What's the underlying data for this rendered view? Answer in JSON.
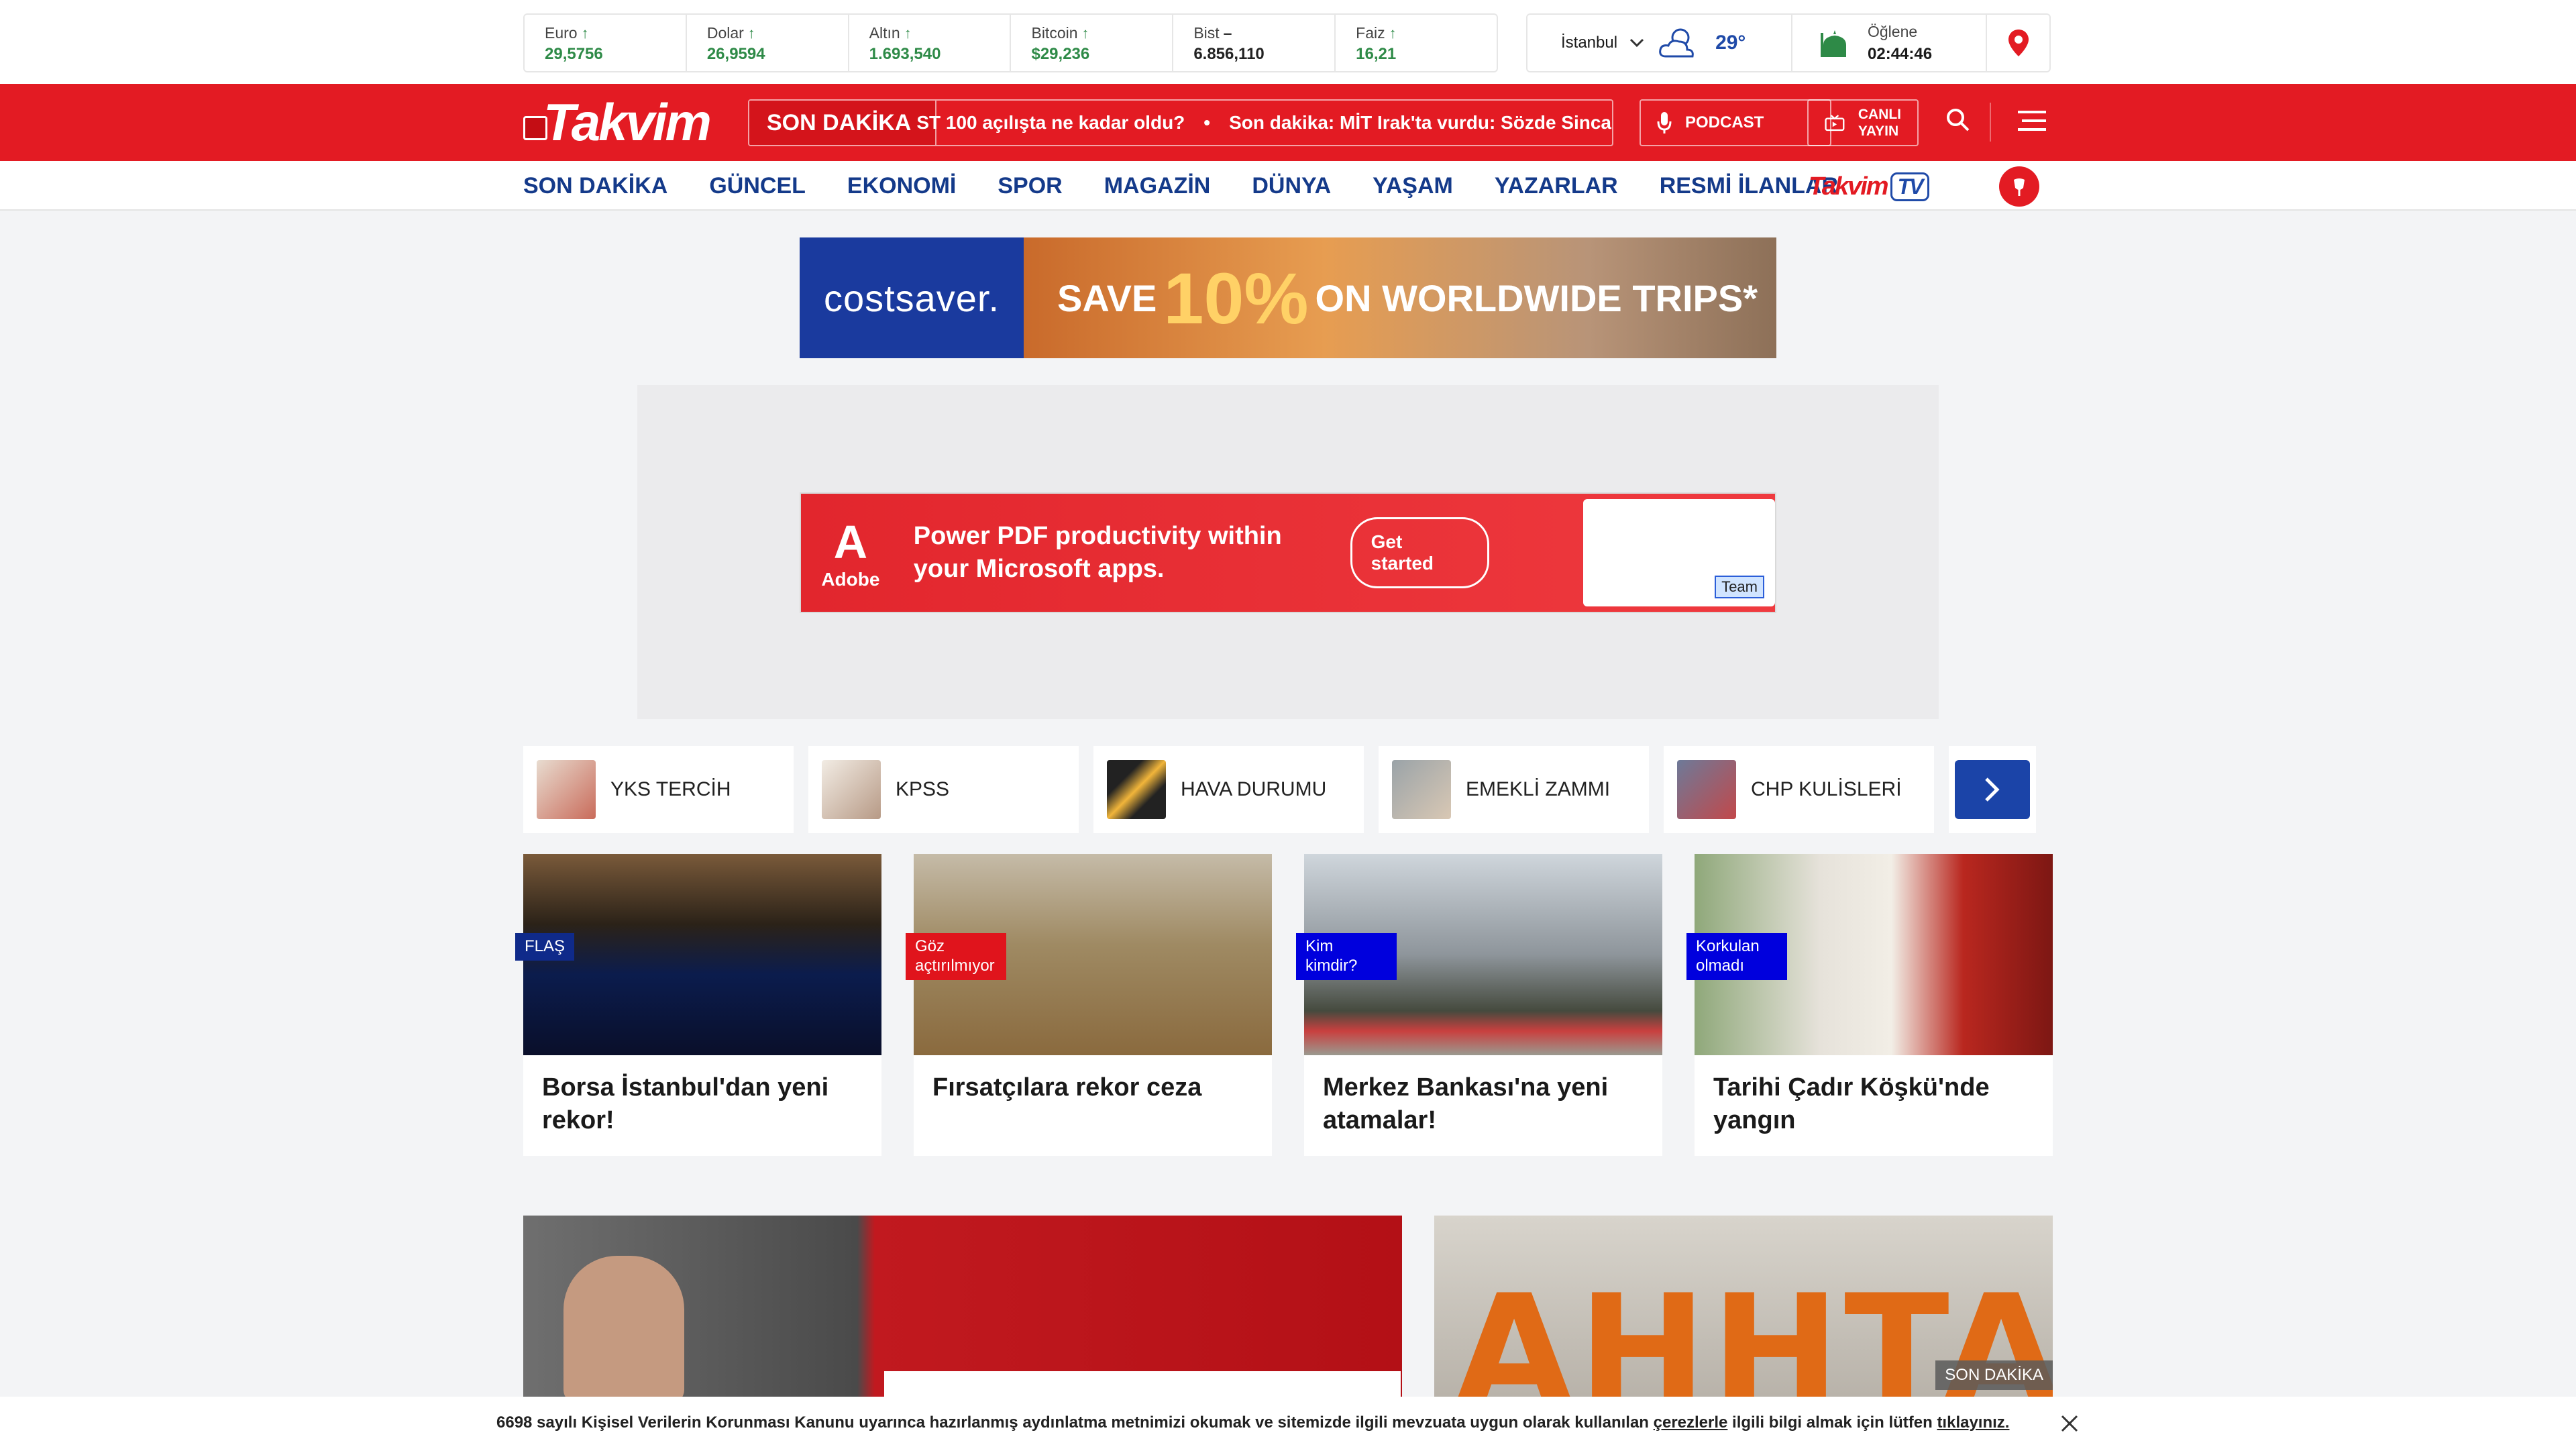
{
  "markets": [
    {
      "name": "Euro",
      "value": "29,5756",
      "trend": "up"
    },
    {
      "name": "Dolar",
      "value": "26,9594",
      "trend": "up"
    },
    {
      "name": "Altın",
      "value": "1.693,540",
      "trend": "up"
    },
    {
      "name": "Bitcoin",
      "value": "$29,236",
      "trend": "up"
    },
    {
      "name": "Bist",
      "value": "6.856,110",
      "trend": "flat"
    },
    {
      "name": "Faiz",
      "value": "16,21",
      "trend": "up"
    }
  ],
  "weather": {
    "city": "İstanbul",
    "temp": "29°",
    "prayer_name": "Öğlene",
    "prayer_time": "02:44:46"
  },
  "header": {
    "logo": "Takvim",
    "ticker_label": "SON DAKİKA",
    "ticker_items": [
      "ST 100 açılışta ne kadar oldu?",
      "Son dakika: MİT Irak'ta vurdu: Sözde Sinca"
    ],
    "podcast": "PODCAST",
    "live_line1": "CANLI",
    "live_line2": "YAYIN"
  },
  "nav": {
    "items": [
      "SON DAKİKA",
      "GÜNCEL",
      "EKONOMİ",
      "SPOR",
      "MAGAZİN",
      "DÜNYA",
      "YAŞAM",
      "YAZARLAR",
      "RESMİ İLANLAR"
    ],
    "tv_logo": "Takvim",
    "tv_badge": "TV"
  },
  "ads": {
    "costsaver_brand": "costsaver.",
    "costsaver_pre": "SAVE",
    "costsaver_pct": "10%",
    "costsaver_post": "ON WORLDWIDE TRIPS*",
    "adobe_logo": "Adobe",
    "adobe_text": "Power PDF productivity within your Microsoft apps.",
    "adobe_cta": "Get started",
    "adobe_thumb": "Team"
  },
  "topics": [
    "YKS TERCİH",
    "KPSS",
    "HAVA DURUMU",
    "EMEKLİ ZAMMI",
    "CHP KULİSLERİ"
  ],
  "cards": [
    {
      "tag": "FLAŞ",
      "title": "Borsa İstanbul'dan yeni rekor!"
    },
    {
      "tag": "Göz açtırılmıyor",
      "title": "Fırsatçılara rekor ceza"
    },
    {
      "tag": "Kim kimdir?",
      "title": "Merkez Bankası'na yeni atamalar!"
    },
    {
      "tag": "Korkulan olmadı",
      "title": "Tarihi Çadır Köşkü'nde yangın"
    }
  ],
  "big2": {
    "word": "AHHTAIYA",
    "badge": "SON DAKİKA"
  },
  "cookie": {
    "text_before": "6698 sayılı Kişisel Verilerin Korunması Kanunu uyarınca hazırlanmış aydınlatma metnimizi okumak ve sitemizde ilgili mevzuata uygun olarak kullanılan ",
    "link1": "çerezlerle",
    "text_mid": " ilgili bilgi almak için lütfen ",
    "link2": "tıklayınız."
  }
}
